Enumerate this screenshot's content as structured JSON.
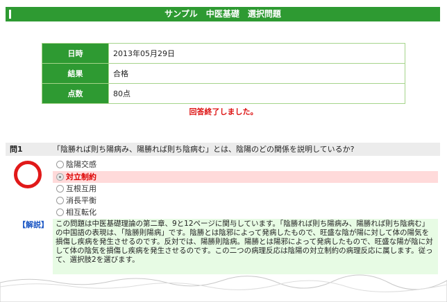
{
  "title": "サンプル　中医基礎　選択問題",
  "result": {
    "rows": [
      {
        "label": "日時",
        "value": "2013年05月29日"
      },
      {
        "label": "結果",
        "value": "合格"
      },
      {
        "label": "点数",
        "value": "80点"
      }
    ]
  },
  "complete_message": "回答終了しました。",
  "question": {
    "number": "問1",
    "text": "「陰勝れば則ち陽病み、陽勝れば則ち陰病む」とは、陰陽のどの関係を説明しているか?",
    "mark_icon": "correct-circle-icon",
    "choices": [
      {
        "label": "陰陽交感",
        "selected": false
      },
      {
        "label": "対立制約",
        "selected": true
      },
      {
        "label": "互根互用",
        "selected": false
      },
      {
        "label": "消長平衡",
        "selected": false
      },
      {
        "label": "相互転化",
        "selected": false
      }
    ]
  },
  "explanation": {
    "label": "【解説】",
    "text": "この問題は中医基礎理論の第二章、9と12ページに関与しています。「陰勝れば則ち陽病み、陽勝れば則ち陰病む」の中国語の表現は、「陰勝則陽病」です。陰勝とは陰邪によって発病したもので、旺盛な陰が陽に対して体の陽気を損傷し疾病を発生させるのです。反対では、陽勝則陰病。陽勝とは陽邪によって発病したもので、旺盛な陽が陰に対して体の陰気を損傷し疾病を発生させるのです。この二つの病理反応は陰陽の対立制約の病理反応に属します。従って、選択肢2を選びます。"
  },
  "colors": {
    "header_green": "#2e9a32",
    "complete_red": "#dd1111",
    "selected_bg": "#ffdada",
    "explanation_bg": "#e7fbe4",
    "explanation_label": "#1a56c4"
  }
}
